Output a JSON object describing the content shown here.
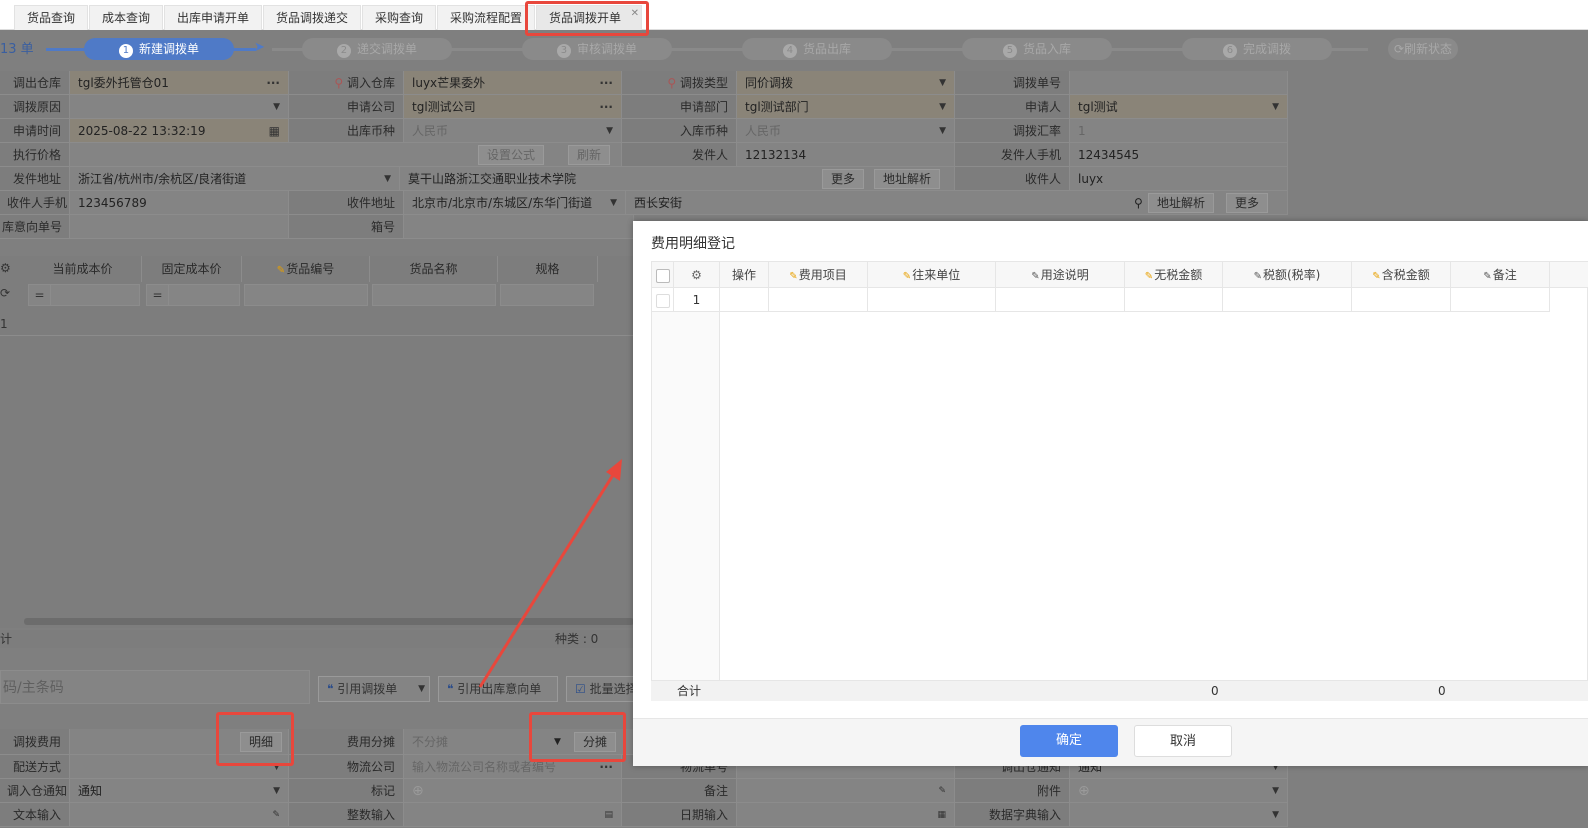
{
  "tabs": [
    {
      "label": "货品查询"
    },
    {
      "label": "成本查询"
    },
    {
      "label": "出库申请开单"
    },
    {
      "label": "货品调拨递交"
    },
    {
      "label": "采购查询"
    },
    {
      "label": "采购流程配置"
    },
    {
      "label": "货品调拨开单",
      "active": true
    }
  ],
  "progress": {
    "prefix": "13 单",
    "steps": [
      {
        "num": "1",
        "label": "新建调拨单"
      },
      {
        "num": "2",
        "label": "递交调拨单"
      },
      {
        "num": "3",
        "label": "审核调拨单"
      },
      {
        "num": "4",
        "label": "货品出库"
      },
      {
        "num": "5",
        "label": "货品入库"
      },
      {
        "num": "6",
        "label": "完成调拨"
      }
    ],
    "refresh_label": "刷新状态"
  },
  "form": {
    "out_wh_label": "调出仓库",
    "out_wh_value": "tgl委外托管仓01",
    "in_wh_label": "调入仓库",
    "in_wh_value": "luyx芒果委外",
    "type_label": "调拨类型",
    "type_value": "同价调拨",
    "order_no_label": "调拨单号",
    "reason_label": "调拨原因",
    "company_label": "申请公司",
    "company_value": "tgl测试公司",
    "dept_label": "申请部门",
    "dept_value": "tgl测试部门",
    "applicant_label": "申请人",
    "applicant_value": "tgl测试",
    "time_label": "申请时间",
    "time_value": "2025-08-22 13:32:19",
    "out_cur_label": "出库币种",
    "out_cur_value": "人民币",
    "in_cur_label": "入库币种",
    "in_cur_value": "人民币",
    "rate_label": "调拨汇率",
    "rate_value": "1",
    "price_label": "执行价格",
    "set_formula": "设置公式",
    "refresh": "刷新",
    "sender_label": "发件人",
    "sender_value": "12132134",
    "sender_phone_label": "发件人手机",
    "sender_phone_value": "12434545",
    "send_addr_label": "发件地址",
    "send_addr_value": "浙江省/杭州市/余杭区/良渚街道",
    "send_addr_detail": "莫干山路浙江交通职业技术学院",
    "more": "更多",
    "parse_addr": "地址解析",
    "receiver_label": "收件人",
    "receiver_value": "luyx",
    "recv_phone_label": "收件人手机",
    "recv_phone_value": "123456789",
    "recv_addr_label": "收件地址",
    "recv_addr_value": "北京市/北京市/东城区/东华门街道",
    "recv_addr_detail": "西长安街",
    "intent_no_label": "库意向单号",
    "box_label": "箱号"
  },
  "grid": {
    "headers": [
      "当前成本价",
      "固定成本价",
      "货品编号",
      "货品名称",
      "规格"
    ],
    "eq": "=",
    "row_num": "1",
    "kinds": "种类 : 0",
    "total_short": "计"
  },
  "bottom": {
    "barcode_placeholder": "码/主条码",
    "ref_transfer": "引用调拨单",
    "ref_intent": "引用出库意向单",
    "batch_select": "批量选择",
    "fee_label": "调拨费用",
    "detail_btn": "明细",
    "fee_split_label": "费用分摊",
    "fee_split_value": "不分摊",
    "split_btn": "分摊",
    "delivery_label": "配送方式",
    "logistics_label": "物流公司",
    "logistics_placeholder": "输入物流公司名称或者编号",
    "logistics_no_label": "物流单号",
    "out_notice_label": "调出仓通知",
    "out_notice_value": "通知",
    "in_notice_label": "调入仓通知",
    "in_notice_value": "通知",
    "mark_label": "标记",
    "remark_label": "备注",
    "attach_label": "附件",
    "text_input_label": "文本输入",
    "int_input_label": "整数输入",
    "date_input_label": "日期输入",
    "dict_input_label": "数据字典输入"
  },
  "modal": {
    "title": "费用明细登记",
    "headers": [
      "操作",
      "费用项目",
      "往来单位",
      "用途说明",
      "无税金额",
      "税额(税率)",
      "含税金额",
      "备注"
    ],
    "row_num": "1",
    "total_label": "合计",
    "total_untaxed": "0",
    "total_taxed": "0",
    "ok": "确定",
    "cancel": "取消"
  },
  "colors": {
    "accent": "#4f86ec",
    "highlight": "#e8473c",
    "step_active": "#4f7ac7"
  }
}
